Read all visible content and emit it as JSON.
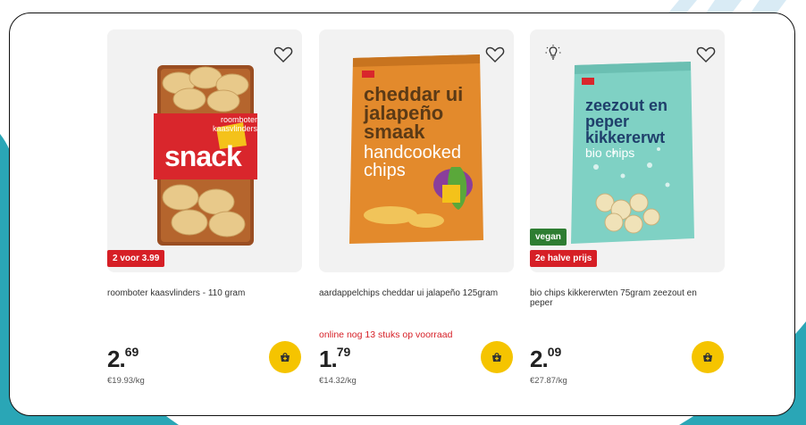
{
  "colors": {
    "accent_yellow": "#f5c400",
    "promo_red": "#d61f26",
    "vegan_green": "#2e7d32",
    "background_teal": "#2aa6b6"
  },
  "products": [
    {
      "name": "roomboter kaasvlinders - 110 gram",
      "price_whole": "2",
      "price_cents": "69",
      "unit_price": "€19.93/kg",
      "badges": [
        "2 voor 3.99"
      ],
      "stock_note": "",
      "package_text": [
        "roomboter",
        "kaasvlinders",
        "snack"
      ],
      "favorite_icon": "heart-outline-icon",
      "cart_icon": "basket-icon"
    },
    {
      "name": "aardappelchips cheddar ui jalapeño 125gram",
      "price_whole": "1",
      "price_cents": "79",
      "unit_price": "€14.32/kg",
      "badges": [],
      "stock_note": "online nog 13 stuks op voorraad",
      "package_text": [
        "cheddar ui",
        "jalapeño",
        "smaak",
        "handcooked",
        "chips"
      ],
      "favorite_icon": "heart-outline-icon",
      "cart_icon": "basket-icon"
    },
    {
      "name": "bio chips kikkererwten 75gram zeezout en peper",
      "price_whole": "2",
      "price_cents": "09",
      "unit_price": "€27.87/kg",
      "badges": [
        "vegan",
        "2e halve prijs"
      ],
      "stock_note": "",
      "package_text": [
        "zeezout en",
        "peper",
        "kikkererwt",
        "bio chips"
      ],
      "favorite_icon": "heart-outline-icon",
      "cart_icon": "basket-icon",
      "tip_icon": "lightbulb-icon"
    }
  ]
}
